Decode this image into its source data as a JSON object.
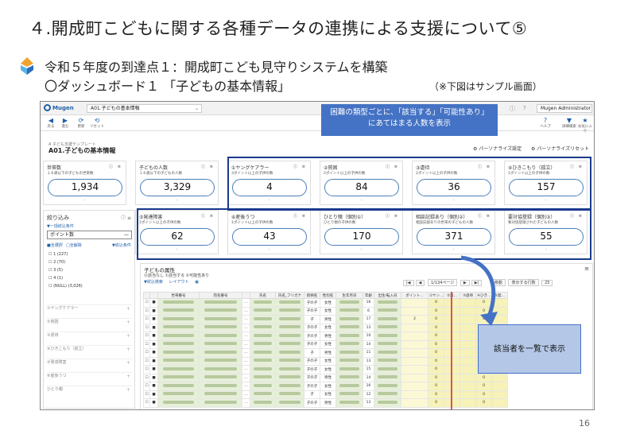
{
  "slide": {
    "title": "４.開成町こどもに関する各種データの連携による支援について⑤",
    "subtitle1": "令和５年度の到達点１：開成町こども見守りシステムを構築",
    "subtitle2": "〇ダッシュボード１ 「子どもの基本情報」",
    "note": "（※下図はサンプル画面）",
    "page_number": "16"
  },
  "callouts": {
    "top": "困難の類型ごとに、「該当する」「可能性あり」\nにあてはまる人数を表示",
    "top_line1": "困難の類型ごとに、「該当する」「可能性あり」",
    "top_line2": "にあてはまる人数を表示",
    "bottom": "該当者を一覧で表示"
  },
  "app": {
    "brand": "Mugen",
    "tab_select": "A01.子どもの基本情報",
    "user": "Mugen Administrator",
    "toolbar": [
      {
        "icon": "back-icon",
        "glyph": "◀",
        "label": "戻る"
      },
      {
        "icon": "forward-icon",
        "glyph": "▶",
        "label": "進む"
      },
      {
        "icon": "refresh-icon",
        "glyph": "⟳",
        "label": "更新"
      },
      {
        "icon": "reset-icon",
        "glyph": "⟲",
        "label": "リセット"
      }
    ],
    "toolbar_right": [
      {
        "icon": "help-icon",
        "glyph": "?",
        "label": "ヘルプ"
      },
      {
        "icon": "filter-icon",
        "glyph": "▼",
        "label": "詳細検索"
      },
      {
        "icon": "star-icon",
        "glyph": "★",
        "label": "お気に入り"
      }
    ],
    "breadcrumb": "A 子ども支援テンプレート",
    "page_heading": "A01.子どもの基本情報",
    "personalize_settings": "パーソナライズ設定",
    "personalize_reset": "パーソナライズリセット"
  },
  "cards": [
    {
      "title": "世帯数",
      "sub": "１８歳以下の子どもの世帯数",
      "value": "1,934"
    },
    {
      "title": "子どもの人数",
      "sub": "１８歳以下の子どもの人数",
      "value": "3,329"
    },
    {
      "title": "①ヤングケアラー",
      "sub": "3ポイント以上の子供の数",
      "value": "4"
    },
    {
      "title": "②貧困",
      "sub": "2ポイント以上の子供の数",
      "value": "84"
    },
    {
      "title": "③虐待",
      "sub": "2ポイント以上の子供の数",
      "value": "36"
    },
    {
      "title": "④ひきこもり（孤立）",
      "sub": "1ポイント以上の子供の数",
      "value": "157"
    },
    {
      "title": "⑤発達障害",
      "sub": "2ポイント以上の子供の数",
      "value": "62"
    },
    {
      "title": "⑥産後うつ",
      "sub": "1ポイント以上の子供の数",
      "value": "43"
    },
    {
      "title": "ひとり親（個別①）",
      "sub": "ひとり親の子供の数",
      "value": "170"
    },
    {
      "title": "相談記録あり（個別②）",
      "sub": "相談記録ありの世帯の子どもの人数",
      "value": "371"
    },
    {
      "title": "要対協登録（個別③）",
      "sub": "要対協登録された子どもの人数",
      "value": "55"
    }
  ],
  "sidebar": {
    "title": "絞り込み",
    "link": "▼一括絞込条件",
    "select": "ポイント数",
    "select_all": "■全選択",
    "deselect_all": "□全解除",
    "filter": "▼絞込条件",
    "options": [
      "1 (227)",
      "2 (70)",
      "3 (5)",
      "4 (1)",
      "(NULL) (3,026)"
    ],
    "groups": [
      "①ヤングケアラー",
      "②貧困",
      "③虐待",
      "④ひきこもり（孤立）",
      "⑤発達障害",
      "⑥産後うつ",
      "ひとり親"
    ]
  },
  "table": {
    "title": "子どもの属性",
    "legend": "⓪該当なし ①該当する ②可能性あり",
    "btn_filter": "▼絞込検索",
    "btn_layout": "レイアウト",
    "pager": "1/134ページ",
    "goto": "移動",
    "rows_label": "表示する行数",
    "rows_value": "25",
    "columns": [
      "",
      "",
      "世帯番号",
      "宛名番号",
      "",
      "氏名",
      "氏名_フリガナ",
      "続柄名",
      "性別名",
      "生年月日",
      "年齢",
      "出生/転入日",
      "ポイント…",
      "①ヤン…",
      "②貧…",
      "③虐待",
      "④ひき…",
      "⑤発…"
    ],
    "rows": [
      [
        "子の子",
        "女性",
        "16",
        "",
        "0",
        "",
        "",
        "0",
        "",
        ""
      ],
      [
        "子の子",
        "女性",
        "6",
        "",
        "0",
        "",
        "",
        "0",
        "",
        ""
      ],
      [
        "子",
        "男性",
        "17",
        "2",
        "0",
        "",
        "",
        "0",
        "",
        ""
      ],
      [
        "子の子",
        "女性",
        "13",
        "",
        "0",
        "",
        "",
        "0",
        "",
        ""
      ],
      [
        "子の子",
        "男性",
        "10",
        "",
        "0",
        "",
        "",
        "0",
        "",
        ""
      ],
      [
        "子の子",
        "女性",
        "14",
        "",
        "0",
        "",
        "",
        "0",
        "",
        ""
      ],
      [
        "子",
        "男性",
        "11",
        "",
        "0",
        "",
        "",
        "0",
        "",
        ""
      ],
      [
        "子の子",
        "女性",
        "13",
        "",
        "0",
        "",
        "",
        "0",
        "",
        ""
      ],
      [
        "子の子",
        "女性",
        "15",
        "",
        "0",
        "",
        "",
        "0",
        "",
        ""
      ],
      [
        "子の子",
        "男性",
        "14",
        "",
        "0",
        "",
        "",
        "0",
        "",
        ""
      ],
      [
        "子の子",
        "女性",
        "16",
        "",
        "0",
        "",
        "",
        "0",
        "",
        ""
      ],
      [
        "子",
        "女性",
        "12",
        "",
        "0",
        "",
        "",
        "0",
        "",
        ""
      ],
      [
        "子の子",
        "男性",
        "13",
        "",
        "0",
        "",
        "",
        "0",
        "",
        ""
      ]
    ]
  },
  "colors": {
    "highlight": "#1a3a8c",
    "callout": "#4472c4",
    "callout_light": "#b4c7e7",
    "pill_border": "#4a7fb8",
    "row_yellow": "#f6f2b8"
  }
}
